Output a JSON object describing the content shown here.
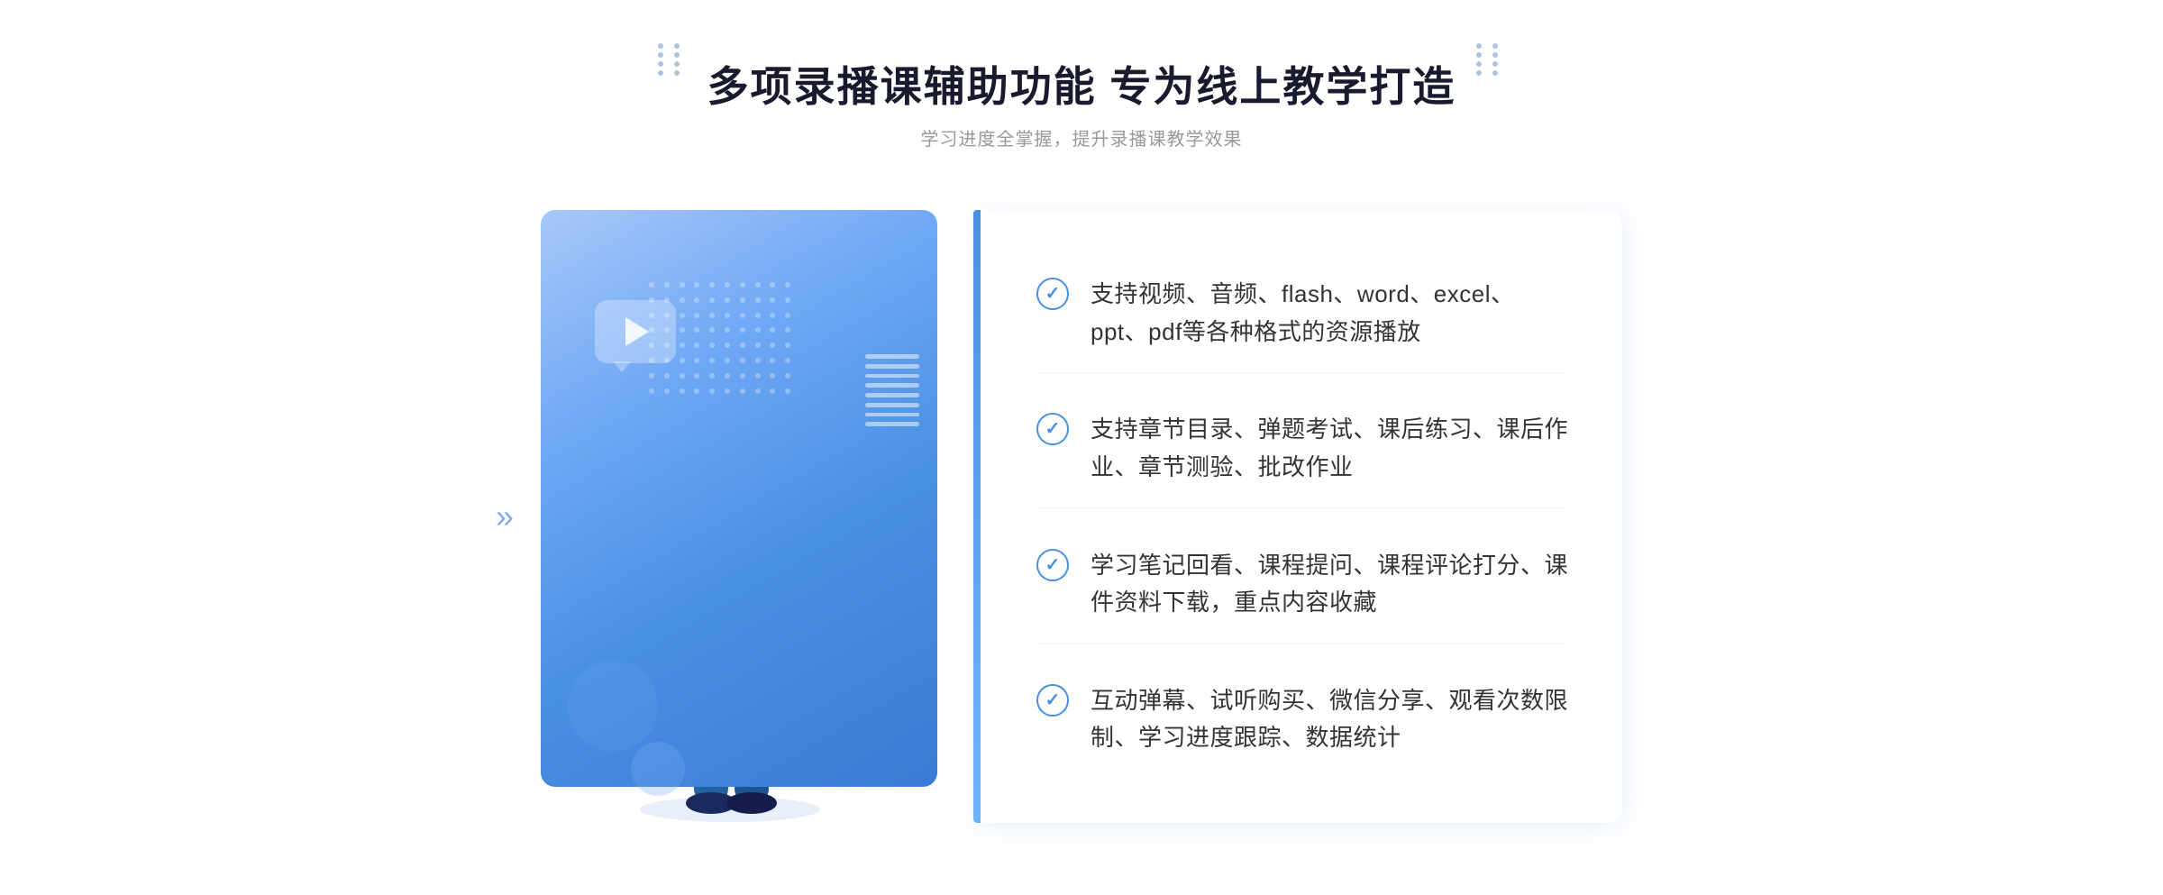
{
  "header": {
    "main_title": "多项录播课辅助功能 专为线上教学打造",
    "sub_title": "学习进度全掌握，提升录播课教学效果"
  },
  "features": [
    {
      "id": "feature-1",
      "text": "支持视频、音频、flash、word、excel、ppt、pdf等各种格式的资源播放"
    },
    {
      "id": "feature-2",
      "text": "支持章节目录、弹题考试、课后练习、课后作业、章节测验、批改作业"
    },
    {
      "id": "feature-3",
      "text": "学习笔记回看、课程提问、课程评论打分、课件资料下载，重点内容收藏"
    },
    {
      "id": "feature-4",
      "text": "互动弹幕、试听购买、微信分享、观看次数限制、学习进度跟踪、数据统计"
    }
  ],
  "icons": {
    "check": "✓",
    "chevron": "»",
    "play": "▶"
  },
  "colors": {
    "accent": "#4a90e2",
    "accent_light": "#6bb5ff",
    "text_dark": "#1a1a2e",
    "text_gray": "#999",
    "text_body": "#333"
  }
}
